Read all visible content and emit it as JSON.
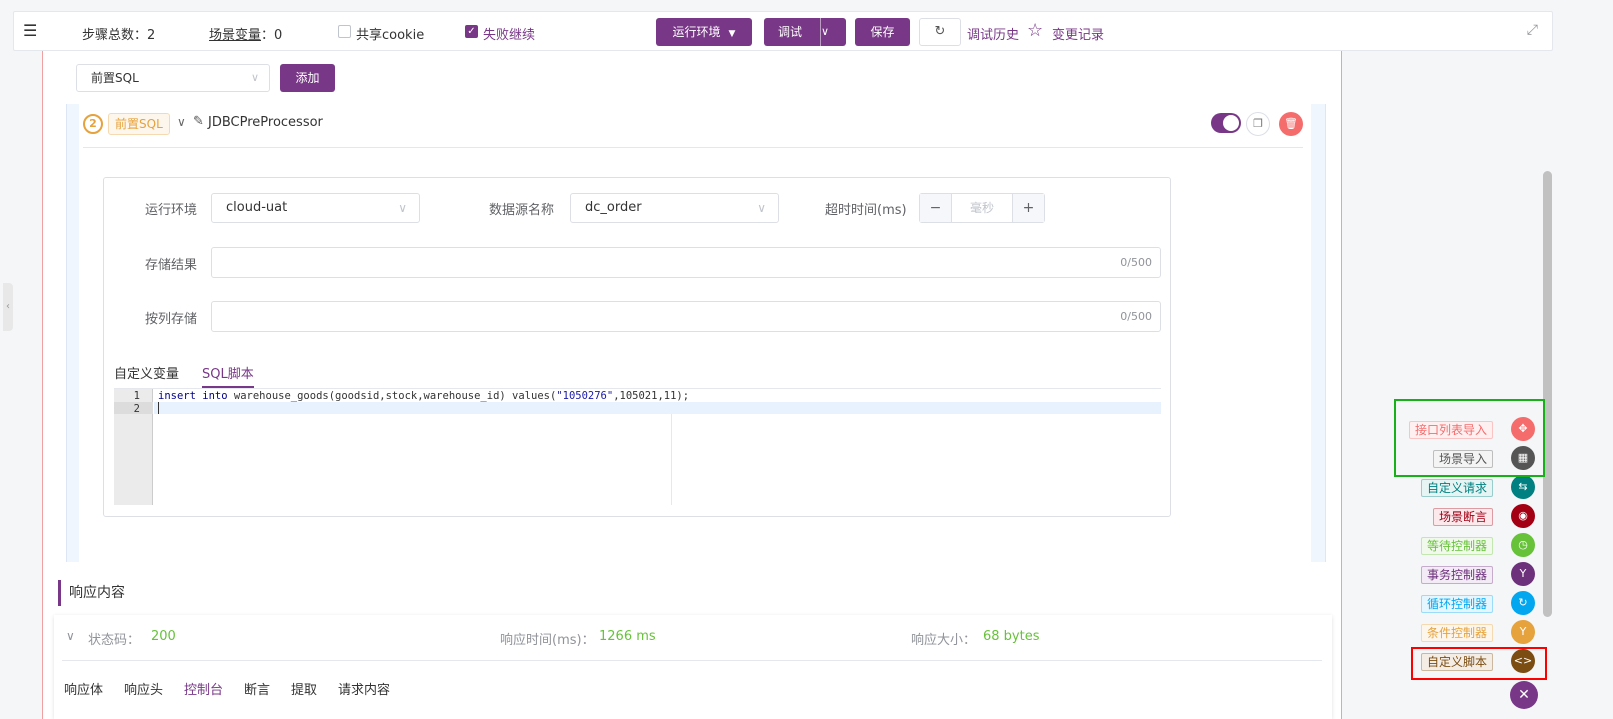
{
  "topbar": {
    "step_count_label": "步骤总数：2",
    "scene_var_label": "场景变量",
    "scene_var_value": "：0",
    "share_cookie_label": "共享cookie",
    "fail_continue_label": "失败继续",
    "run_env_label": "运行环境",
    "debug_label": "调试",
    "save_label": "保存",
    "debug_history_label": "调试历史",
    "change_record_label": "变更记录"
  },
  "toolbar": {
    "sql_select_value": "前置SQL",
    "add_label": "添加"
  },
  "step": {
    "number": "2",
    "tag": "前置SQL",
    "name": "JDBCPreProcessor",
    "enabled": true
  },
  "form": {
    "run_env_label": "运行环境",
    "run_env_value": "cloud-uat",
    "datasource_label": "数据源名称",
    "datasource_value": "dc_order",
    "timeout_label": "超时时间(ms)",
    "timeout_placeholder": "毫秒",
    "store_result_label": "存储结果",
    "store_result_count": "0/500",
    "store_by_column_label": "按列存储",
    "store_by_column_count": "0/500"
  },
  "script_tabs": {
    "custom_var": "自定义变量",
    "sql_script": "SQL脚本"
  },
  "editor": {
    "line_numbers": [
      "1",
      "2"
    ],
    "code_insert": "insert",
    "code_into": "into",
    "code_middle": " warehouse_goods(goodsid,stock,warehouse_id) values(",
    "code_string": "\"1050276\"",
    "code_tail": ",105021,11);"
  },
  "response": {
    "section_title": "响应内容",
    "status_label": "状态码：",
    "status_value": "200",
    "time_label": "响应时间(ms)：",
    "time_value": "1266 ms",
    "size_label": "响应大小：",
    "size_value": "68 bytes",
    "tabs": [
      "响应体",
      "响应头",
      "控制台",
      "断言",
      "提取",
      "请求内容"
    ],
    "active_tab": "控制台"
  },
  "fab": {
    "items": [
      {
        "label": "接口列表导入",
        "color": "#f56c6c",
        "bg": "#fef0f0",
        "icon": "move-icon",
        "glyph": "✥"
      },
      {
        "label": "场景导入",
        "color": "#555555",
        "bg": "#f4f4f5",
        "icon": "film-icon",
        "glyph": "▦"
      },
      {
        "label": "自定义请求",
        "color": "#008080",
        "bg": "#e6f4f4",
        "icon": "sliders-icon",
        "glyph": "⇆"
      },
      {
        "label": "场景断言",
        "color": "#a30014",
        "bg": "#fbe9ec",
        "icon": "assert-icon",
        "glyph": "◉"
      },
      {
        "label": "等待控制器",
        "color": "#67c23a",
        "bg": "#f0f9eb",
        "icon": "clock-icon",
        "glyph": "◷"
      },
      {
        "label": "事务控制器",
        "color": "#6d317c",
        "bg": "#f3ebf5",
        "icon": "branch-icon",
        "glyph": "Y"
      },
      {
        "label": "循环控制器",
        "color": "#02a7f0",
        "bg": "#e6f6fe",
        "icon": "loop-icon",
        "glyph": "↻"
      },
      {
        "label": "条件控制器",
        "color": "#e6a23c",
        "bg": "#fdf6ec",
        "icon": "fork-icon",
        "glyph": "Y"
      },
      {
        "label": "自定义脚本",
        "color": "#7b4d12",
        "bg": "#f4ede6",
        "icon": "code-icon",
        "glyph": "<>"
      }
    ],
    "close_glyph": "✕"
  }
}
